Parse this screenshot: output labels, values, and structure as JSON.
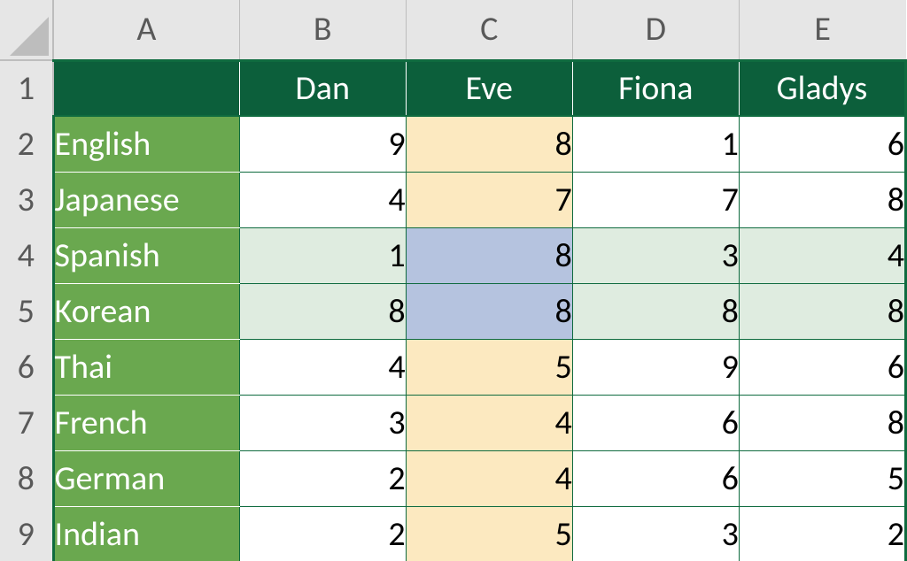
{
  "columns_letters": [
    "A",
    "B",
    "C",
    "D",
    "E"
  ],
  "row_numbers": [
    "1",
    "2",
    "3",
    "4",
    "5",
    "6",
    "7",
    "8",
    "9"
  ],
  "header": {
    "blank": "",
    "names": [
      "Dan",
      "Eve",
      "Fiona",
      "Gladys"
    ]
  },
  "rows": [
    {
      "label": "English",
      "vals": [
        "9",
        "8",
        "1",
        "6"
      ]
    },
    {
      "label": "Japanese",
      "vals": [
        "4",
        "7",
        "7",
        "8"
      ]
    },
    {
      "label": "Spanish",
      "vals": [
        "1",
        "8",
        "3",
        "4"
      ]
    },
    {
      "label": "Korean",
      "vals": [
        "8",
        "8",
        "8",
        "8"
      ]
    },
    {
      "label": "Thai",
      "vals": [
        "4",
        "5",
        "9",
        "6"
      ]
    },
    {
      "label": "French",
      "vals": [
        "3",
        "4",
        "6",
        "8"
      ]
    },
    {
      "label": "German",
      "vals": [
        "2",
        "4",
        "6",
        "5"
      ]
    },
    {
      "label": "Indian",
      "vals": [
        "2",
        "5",
        "3",
        "2"
      ]
    }
  ],
  "highlight": {
    "yellow_column_index": 1,
    "green_rows": [
      2,
      3
    ],
    "blue_cells": [
      [
        2,
        1
      ],
      [
        3,
        1
      ]
    ]
  },
  "chart_data": {
    "type": "table",
    "title": "",
    "columns": [
      "Dan",
      "Eve",
      "Fiona",
      "Gladys"
    ],
    "rows": [
      "English",
      "Japanese",
      "Spanish",
      "Korean",
      "Thai",
      "French",
      "German",
      "Indian"
    ],
    "values": [
      [
        9,
        8,
        1,
        6
      ],
      [
        4,
        7,
        7,
        8
      ],
      [
        1,
        8,
        3,
        4
      ],
      [
        8,
        8,
        8,
        8
      ],
      [
        4,
        5,
        9,
        6
      ],
      [
        3,
        4,
        6,
        8
      ],
      [
        2,
        4,
        6,
        5
      ],
      [
        2,
        5,
        3,
        2
      ]
    ]
  }
}
